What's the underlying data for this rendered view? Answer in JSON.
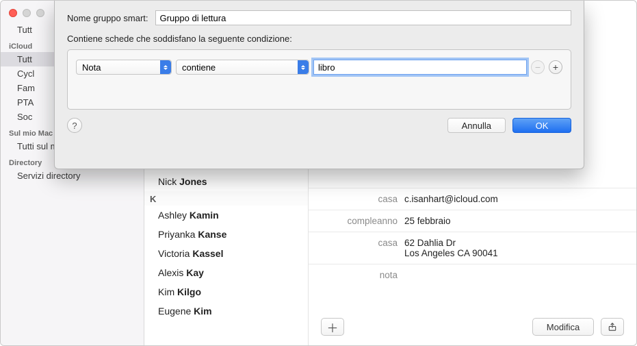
{
  "sidebar": {
    "top_item": "Tutt",
    "sections": [
      {
        "header": "iCloud",
        "items": [
          "Tutt",
          "Cycl",
          "Fam",
          "PTA",
          "Soc"
        ]
      },
      {
        "header": "Sul mio Mac",
        "items": [
          "Tutti sul mio Mac"
        ]
      },
      {
        "header": "Directory",
        "items": [
          "Servizi directory"
        ]
      }
    ]
  },
  "contacts": {
    "above": {
      "first": "Nick",
      "last": "Jones"
    },
    "section_letter": "K",
    "list": [
      {
        "first": "Ashley",
        "last": "Kamin"
      },
      {
        "first": "Priyanka",
        "last": "Kanse"
      },
      {
        "first": "Victoria",
        "last": "Kassel"
      },
      {
        "first": "Alexis",
        "last": "Kay"
      },
      {
        "first": "Kim",
        "last": "Kilgo"
      },
      {
        "first": "Eugene",
        "last": "Kim"
      }
    ]
  },
  "detail": {
    "rows": [
      {
        "label": "casa",
        "value": "c.isanhart@icloud.com"
      },
      {
        "label": "compleanno",
        "value": "25 febbraio"
      },
      {
        "label": "casa",
        "value": "62 Dahlia Dr\nLos Angeles CA 90041"
      },
      {
        "label": "nota",
        "value": ""
      }
    ],
    "edit_button": "Modifica"
  },
  "dialog": {
    "name_label": "Nome gruppo smart:",
    "name_value": "Gruppo di lettura",
    "subtitle": "Contiene schede che soddisfano la seguente condizione:",
    "field": "Nota",
    "operator": "contiene",
    "value": "libro",
    "cancel": "Annulla",
    "ok": "OK"
  }
}
